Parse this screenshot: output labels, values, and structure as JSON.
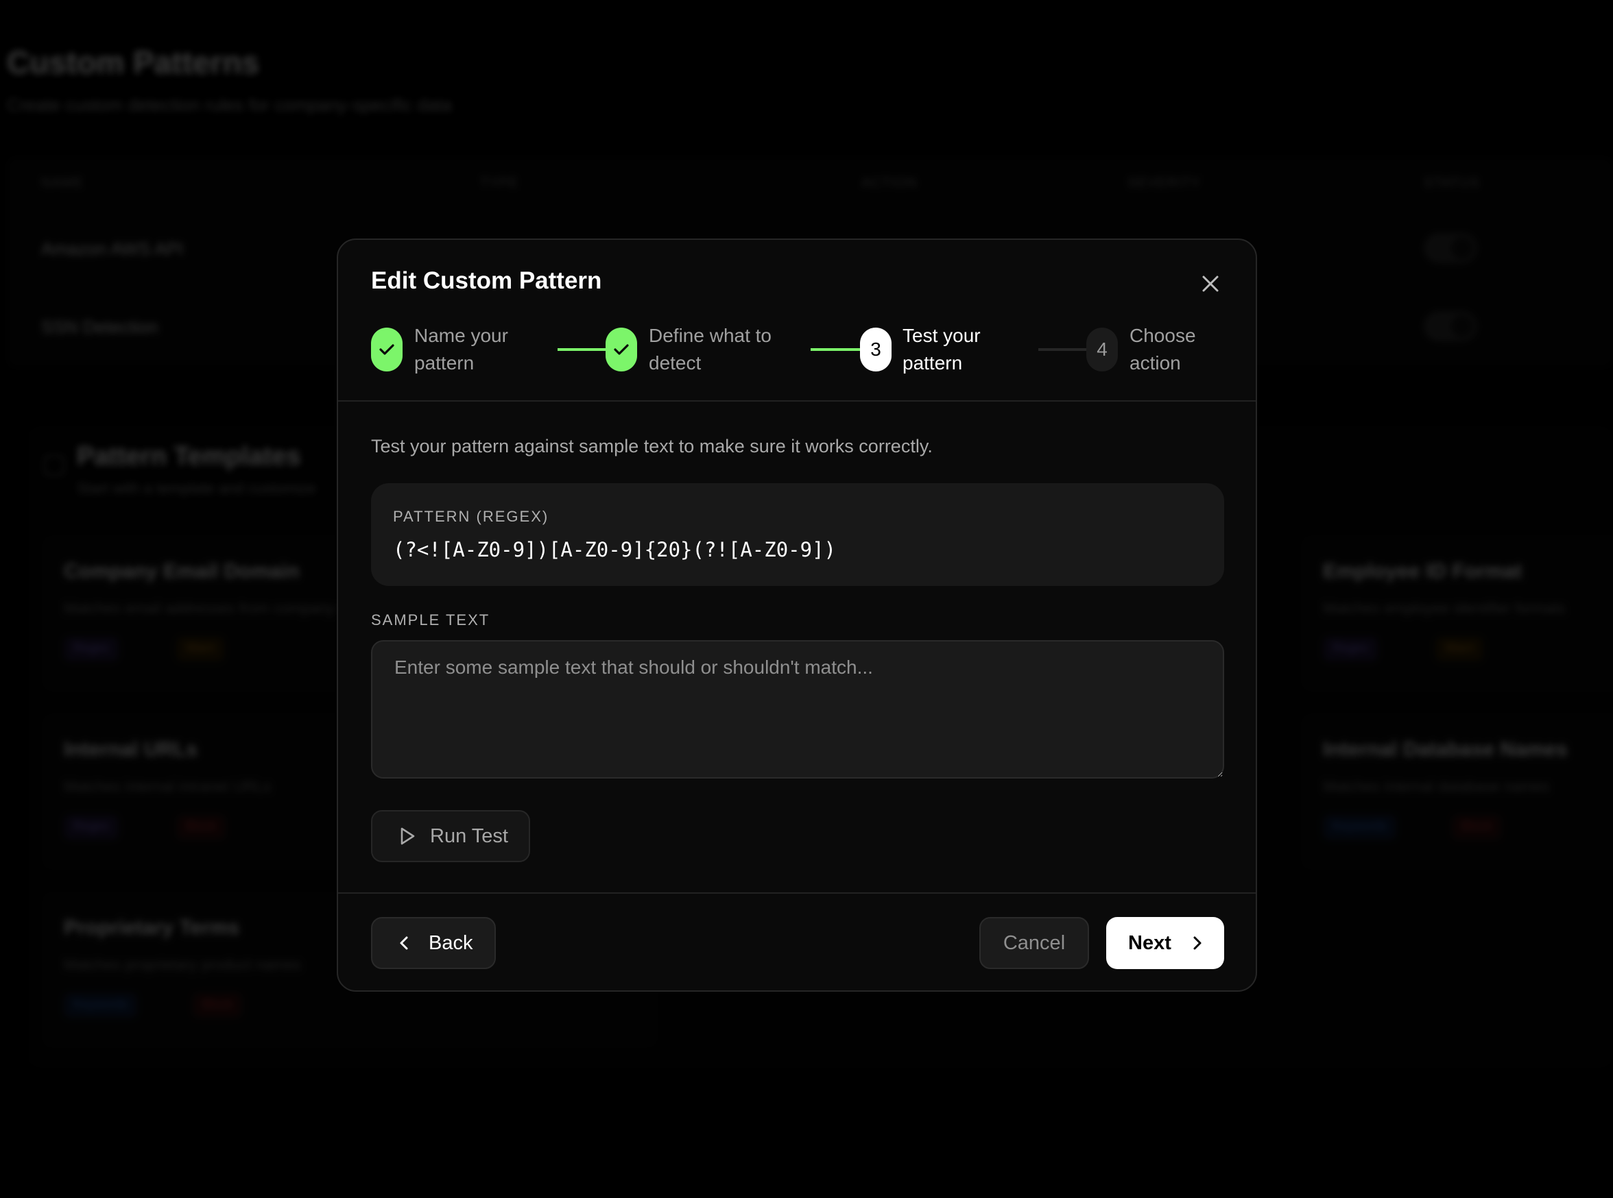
{
  "background": {
    "title": "Custom Patterns",
    "subtitle": "Create custom detection rules for company-specific data",
    "table_headers": [
      "NAME",
      "TYPE",
      "ACTION",
      "SEVERITY",
      "STATUS"
    ],
    "rows": [
      "Amazon AWS API",
      "SSN Detection"
    ],
    "templates": {
      "title": "Pattern Templates",
      "subtitle": "Start with a template and customize",
      "cards": [
        {
          "title": "Company Email Domain",
          "desc": "Matches email addresses from company domain",
          "pills": [
            "Regex",
            "Warn"
          ]
        },
        {
          "title": "Employee ID Format",
          "desc": "Matches employee identifier formats",
          "pills": [
            "Regex",
            "Warn"
          ]
        },
        {
          "title": "Internal URLs",
          "desc": "Matches internal intranet URLs",
          "pills": [
            "Regex",
            "Block"
          ]
        },
        {
          "title": "Internal Database Names",
          "desc": "Matches internal database names",
          "pills": [
            "Keywords",
            "Block"
          ]
        },
        {
          "title": "Proprietary Terms",
          "desc": "Matches proprietary product names",
          "pills": [
            "Keywords",
            "Block"
          ]
        }
      ]
    }
  },
  "modal": {
    "title": "Edit Custom Pattern",
    "close_icon": "close-icon",
    "steps": [
      {
        "number": "1",
        "line1": "Name your",
        "line2": "pattern",
        "state": "done"
      },
      {
        "number": "2",
        "line1": "Define what to",
        "line2": "detect",
        "state": "done"
      },
      {
        "number": "3",
        "line1": "Test your",
        "line2": "pattern",
        "state": "current"
      },
      {
        "number": "4",
        "line1": "Choose",
        "line2": "action",
        "state": "todo"
      }
    ],
    "description": "Test your pattern against sample text to make sure it works correctly.",
    "pattern_label": "PATTERN (REGEX)",
    "pattern_value": "(?<![A-Z0-9])[A-Z0-9]{20}(?![A-Z0-9])",
    "sample_label": "SAMPLE TEXT",
    "sample_placeholder": "Enter some sample text that should or shouldn't match...",
    "sample_value": "",
    "run_test_label": "Run Test",
    "back_label": "Back",
    "cancel_label": "Cancel",
    "next_label": "Next"
  },
  "colors": {
    "accent_green": "#7CF56A",
    "modal_bg": "#0a0a0a",
    "field_bg": "#181818"
  }
}
